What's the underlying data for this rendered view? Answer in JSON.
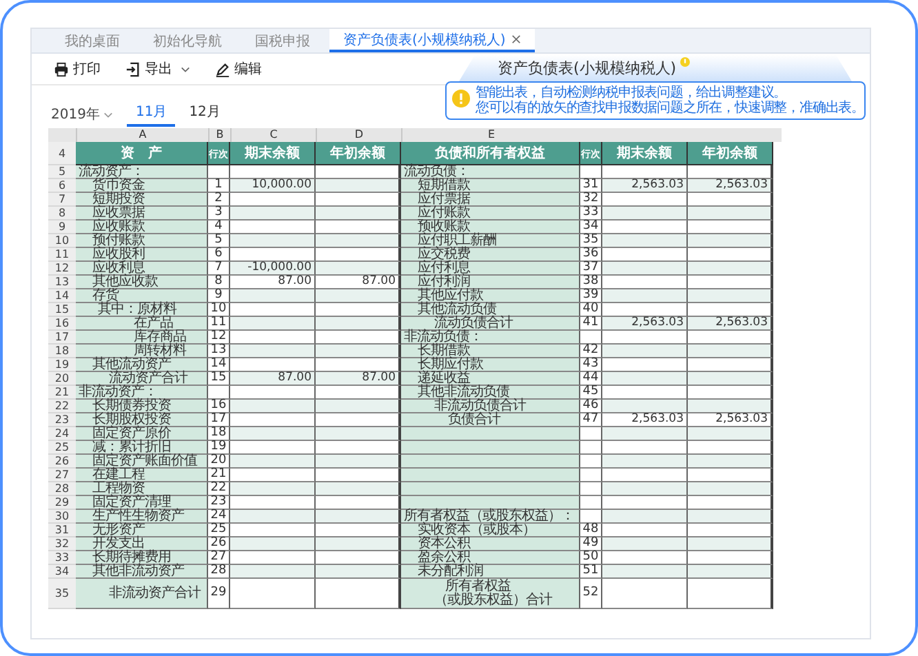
{
  "tabs": [
    {
      "label": "我的桌面",
      "selected": false,
      "closable": false
    },
    {
      "label": "初始化导航",
      "selected": false,
      "closable": false
    },
    {
      "label": "国税申报",
      "selected": false,
      "closable": false
    },
    {
      "label": "资产负债表(小规模纳税人)",
      "selected": true,
      "closable": true
    }
  ],
  "toolbar": [
    {
      "label": "打印",
      "kind": "print"
    },
    {
      "label": "导出",
      "kind": "export"
    },
    {
      "label": "编辑",
      "kind": "edit"
    }
  ],
  "period": {
    "year": "2019年",
    "months": [
      {
        "label": "11月",
        "selected": true
      },
      {
        "label": "12月",
        "selected": false
      }
    ]
  },
  "popup": {
    "title": "资产负债表(小规模纳税人)",
    "lines": [
      "智能出表，自动检测纳税申报表问题，给出调整建议。",
      "您可以有的放矢的查找申报数据问题之所在，快速调整，准确出表。"
    ]
  },
  "sheet": {
    "column_letters": [
      "A",
      "B",
      "C",
      "D",
      "E"
    ],
    "header_row": "4",
    "headers": [
      "资　产",
      "行次",
      "期末余额",
      "年初余额",
      "负债和所有者权益",
      "行次",
      "期末余额",
      "年初余额"
    ],
    "rows": [
      {
        "n": "5",
        "asset": {
          "label": "流动资产：",
          "kind": "section"
        },
        "liability": {
          "label": "流动负债：",
          "kind": "section"
        }
      },
      {
        "n": "6",
        "asset": {
          "label": "货币资金",
          "kind": "item",
          "line": "1",
          "end": "10,000.00"
        },
        "liability": {
          "label": "短期借款",
          "kind": "item",
          "line": "31",
          "end": "2,563.03",
          "start": "2,563.03"
        }
      },
      {
        "n": "7",
        "asset": {
          "label": "短期投资",
          "kind": "item",
          "line": "2"
        },
        "liability": {
          "label": "应付票据",
          "kind": "item",
          "line": "32"
        }
      },
      {
        "n": "8",
        "asset": {
          "label": "应收票据",
          "kind": "item",
          "line": "3"
        },
        "liability": {
          "label": "应付账款",
          "kind": "item",
          "line": "33"
        }
      },
      {
        "n": "9",
        "asset": {
          "label": "应收账款",
          "kind": "item",
          "line": "4"
        },
        "liability": {
          "label": "预收账款",
          "kind": "item",
          "line": "34"
        }
      },
      {
        "n": "10",
        "asset": {
          "label": "预付账款",
          "kind": "item",
          "line": "5"
        },
        "liability": {
          "label": "应付职工薪酬",
          "kind": "item",
          "line": "35"
        }
      },
      {
        "n": "11",
        "asset": {
          "label": "应收股利",
          "kind": "item",
          "line": "6"
        },
        "liability": {
          "label": "应交税费",
          "kind": "item",
          "line": "36"
        }
      },
      {
        "n": "12",
        "asset": {
          "label": "应收利息",
          "kind": "item",
          "line": "7",
          "end": "-10,000.00"
        },
        "liability": {
          "label": "应付利息",
          "kind": "item",
          "line": "37"
        }
      },
      {
        "n": "13",
        "asset": {
          "label": "其他应收款",
          "kind": "item",
          "line": "8",
          "end": "87.00",
          "start": "87.00"
        },
        "liability": {
          "label": "应付利润",
          "kind": "item",
          "line": "38"
        }
      },
      {
        "n": "14",
        "asset": {
          "label": "存货",
          "kind": "item",
          "line": "9"
        },
        "liability": {
          "label": "其他应付款",
          "kind": "item",
          "line": "39"
        }
      },
      {
        "n": "15",
        "asset": {
          "label": "其中：原材料",
          "kind": "sub",
          "line": "10"
        },
        "liability": {
          "label": "其他流动负债",
          "kind": "item",
          "line": "40"
        }
      },
      {
        "n": "16",
        "asset": {
          "label": "在产品",
          "kind": "deep",
          "line": "11"
        },
        "liability": {
          "label": "流动负债合计",
          "kind": "total",
          "line": "41",
          "end": "2,563.03",
          "start": "2,563.03"
        }
      },
      {
        "n": "17",
        "asset": {
          "label": "库存商品",
          "kind": "deep",
          "line": "12"
        },
        "liability": {
          "label": "非流动负债：",
          "kind": "section"
        }
      },
      {
        "n": "18",
        "asset": {
          "label": "周转材料",
          "kind": "deep",
          "line": "13"
        },
        "liability": {
          "label": "长期借款",
          "kind": "item",
          "line": "42"
        }
      },
      {
        "n": "19",
        "asset": {
          "label": "其他流动资产",
          "kind": "item",
          "line": "14"
        },
        "liability": {
          "label": "长期应付款",
          "kind": "item",
          "line": "43"
        }
      },
      {
        "n": "20",
        "asset": {
          "label": "流动资产合计",
          "kind": "total",
          "line": "15",
          "end": "87.00",
          "start": "87.00"
        },
        "liability": {
          "label": "递延收益",
          "kind": "item",
          "line": "44"
        }
      },
      {
        "n": "21",
        "asset": {
          "label": "非流动资产：",
          "kind": "section"
        },
        "liability": {
          "label": "其他非流动负债",
          "kind": "item",
          "line": "45"
        }
      },
      {
        "n": "22",
        "asset": {
          "label": "长期债券投资",
          "kind": "item",
          "line": "16"
        },
        "liability": {
          "label": "非流动负债合计",
          "kind": "total",
          "line": "46"
        }
      },
      {
        "n": "23",
        "asset": {
          "label": "长期股权投资",
          "kind": "item",
          "line": "17"
        },
        "liability": {
          "label": "负债合计",
          "kind": "grand",
          "line": "47",
          "end": "2,563.03",
          "start": "2,563.03"
        }
      },
      {
        "n": "24",
        "asset": {
          "label": "固定资产原价",
          "kind": "item",
          "line": "18"
        },
        "liability": {
          "kind": "item"
        }
      },
      {
        "n": "25",
        "asset": {
          "label": "减：累计折旧",
          "kind": "item",
          "line": "19"
        },
        "liability": {
          "kind": "item"
        }
      },
      {
        "n": "26",
        "asset": {
          "label": "固定资产账面价值",
          "kind": "item",
          "line": "20"
        },
        "liability": {
          "kind": "item"
        }
      },
      {
        "n": "27",
        "asset": {
          "label": "在建工程",
          "kind": "item",
          "line": "21"
        },
        "liability": {
          "kind": "item"
        }
      },
      {
        "n": "28",
        "asset": {
          "label": "工程物资",
          "kind": "item",
          "line": "22"
        },
        "liability": {
          "kind": "item"
        }
      },
      {
        "n": "29",
        "asset": {
          "label": "固定资产清理",
          "kind": "item",
          "line": "23"
        },
        "liability": {
          "kind": "item"
        }
      },
      {
        "n": "30",
        "asset": {
          "label": "生产性生物资产",
          "kind": "item",
          "line": "24"
        },
        "liability": {
          "label": "所有者权益（或股东权益）：",
          "kind": "section"
        }
      },
      {
        "n": "31",
        "asset": {
          "label": "无形资产",
          "kind": "item",
          "line": "25"
        },
        "liability": {
          "label": "实收资本（或股本）",
          "kind": "item",
          "line": "48"
        }
      },
      {
        "n": "32",
        "asset": {
          "label": "开发支出",
          "kind": "item",
          "line": "26"
        },
        "liability": {
          "label": "资本公积",
          "kind": "item",
          "line": "49"
        }
      },
      {
        "n": "33",
        "asset": {
          "label": "长期待摊费用",
          "kind": "item",
          "line": "27"
        },
        "liability": {
          "label": "盈余公积",
          "kind": "item",
          "line": "50"
        }
      },
      {
        "n": "34",
        "asset": {
          "label": "其他非流动资产",
          "kind": "item",
          "line": "28"
        },
        "liability": {
          "label": "未分配利润",
          "kind": "item",
          "line": "51"
        }
      },
      {
        "n": "35",
        "asset": {
          "label": "非流动资产合计",
          "kind": "total",
          "line": "29"
        },
        "liability": {
          "label_lines": [
            "所有者权益",
            "（或股东权益）合计"
          ],
          "kind": "total",
          "line": "52"
        }
      }
    ]
  }
}
